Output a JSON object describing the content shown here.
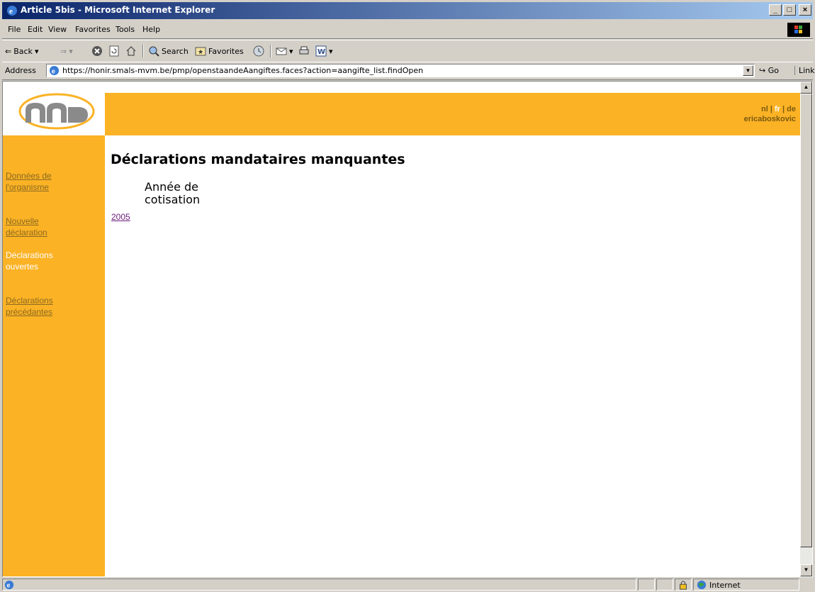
{
  "window": {
    "title": "Article 5bis - Microsoft Internet Explorer",
    "controls": [
      "_",
      "□",
      "×"
    ]
  },
  "menu": [
    "File",
    "Edit",
    "View",
    "Favorites",
    "Tools",
    "Help"
  ],
  "toolbar": {
    "back": "Back",
    "search": "Search",
    "favorites": "Favorites"
  },
  "address": {
    "label": "Address",
    "url": "https://honir.smals-mvm.be/pmp/openstaandeAangiftes.faces?action=aangifte_list.findOpen",
    "go": "Go",
    "links": "Links"
  },
  "page": {
    "lang_nl": "nl",
    "lang_sep": "|",
    "lang_fr": "fr",
    "lang_de": "de",
    "user": "ericaboskovic",
    "nav": [
      {
        "line1": "Données de",
        "line2": "l'organisme",
        "active": false
      },
      {
        "line1": "Nouvelle",
        "line2": "déclaration",
        "active": false
      },
      {
        "line1": "Déclarations",
        "line2": "ouvertes",
        "active": true
      },
      {
        "line1": "Déclarations",
        "line2": "précédantes",
        "active": false
      }
    ],
    "heading": "Déclarations mandataires manquantes",
    "column_header_line1": "Année de",
    "column_header_line2": "cotisation",
    "rows": [
      "2005"
    ]
  },
  "status": {
    "zone": "Internet"
  },
  "colors": {
    "accent": "#fbb225",
    "title_bar": "#0a246a",
    "link_visited": "#6a1b7a"
  }
}
